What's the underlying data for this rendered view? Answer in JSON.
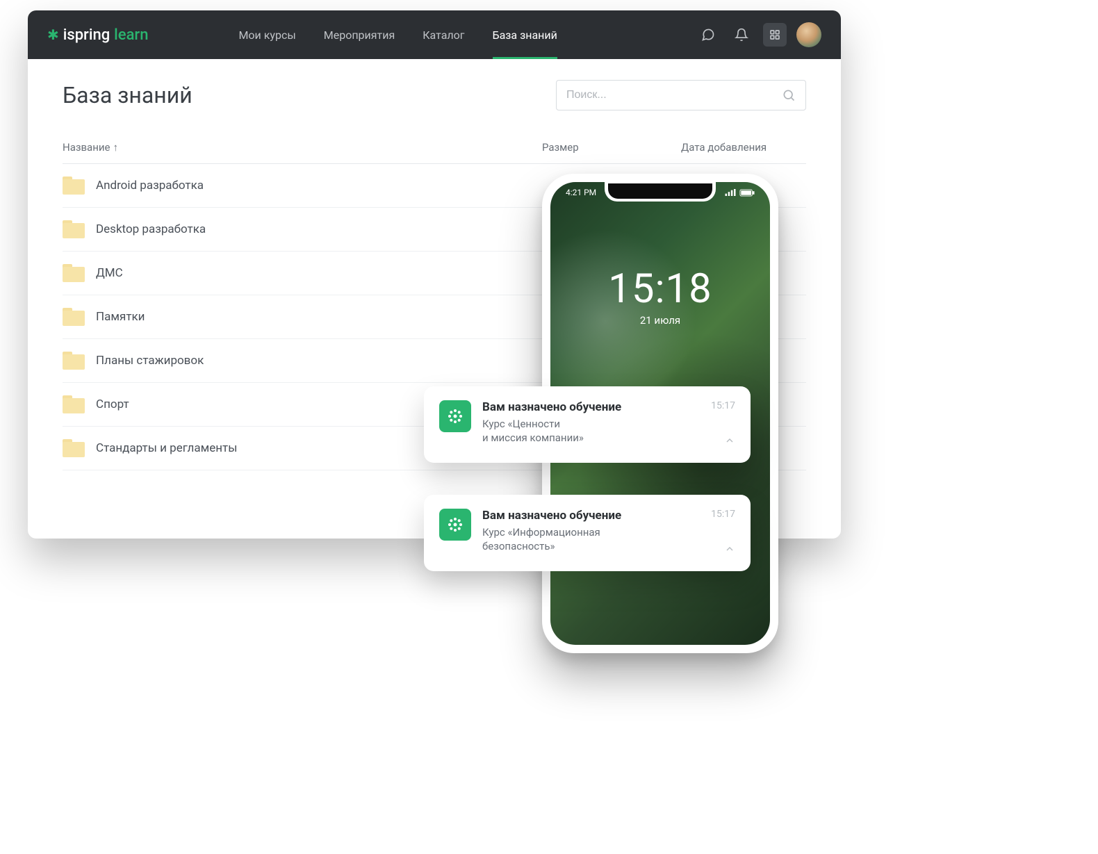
{
  "brand": {
    "ispring": "ispring",
    "learn": "learn"
  },
  "nav": {
    "my_courses": "Мои курсы",
    "events": "Мероприятия",
    "catalog": "Каталог",
    "kb": "База знаний"
  },
  "page": {
    "title": "База знаний",
    "search_placeholder": "Поиск..."
  },
  "columns": {
    "name": "Название",
    "size": "Размер",
    "date": "Дата добавления"
  },
  "folders": [
    {
      "label": "Android разработка"
    },
    {
      "label": "Desktop разработка"
    },
    {
      "label": "ДМС"
    },
    {
      "label": "Памятки"
    },
    {
      "label": "Планы стажировок"
    },
    {
      "label": "Спорт"
    },
    {
      "label": "Стандарты и регламенты"
    }
  ],
  "phone": {
    "status_time": "4:21 PM",
    "lock_time": "15:18",
    "lock_date": "21 июля"
  },
  "notifications": [
    {
      "title": "Вам назначено обучение",
      "body": "Курс «Ценности\nи миссия компании»",
      "time": "15:17"
    },
    {
      "title": "Вам назначено обучение",
      "body": "Курс «Информационная\nбезопасность»",
      "time": "15:17"
    }
  ]
}
